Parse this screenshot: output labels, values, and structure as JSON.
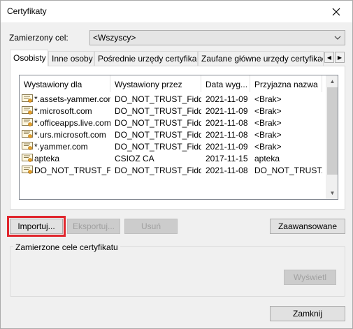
{
  "window": {
    "title": "Certyfikaty"
  },
  "purpose": {
    "label": "Zamierzony cel:",
    "value": "<Wszyscy>"
  },
  "tabs": [
    {
      "label": "Osobisty"
    },
    {
      "label": "Inne osoby"
    },
    {
      "label": "Pośrednie urzędy certyfikacji"
    },
    {
      "label": "Zaufane główne urzędy certyfikacji"
    }
  ],
  "table": {
    "columns": [
      "Wystawiony dla",
      "Wystawiony przez",
      "Data wyg...",
      "Przyjazna nazwa"
    ],
    "rows": [
      {
        "issued_to": "*.assets-yammer.com",
        "issued_by": "DO_NOT_TRUST_Fidd...",
        "expires": "2021-11-09",
        "friendly": "<Brak>"
      },
      {
        "issued_to": "*.microsoft.com",
        "issued_by": "DO_NOT_TRUST_Fidd...",
        "expires": "2021-11-09",
        "friendly": "<Brak>"
      },
      {
        "issued_to": "*.officeapps.live.com",
        "issued_by": "DO_NOT_TRUST_Fidd...",
        "expires": "2021-11-08",
        "friendly": "<Brak>"
      },
      {
        "issued_to": "*.urs.microsoft.com",
        "issued_by": "DO_NOT_TRUST_Fidd...",
        "expires": "2021-11-08",
        "friendly": "<Brak>"
      },
      {
        "issued_to": "*.yammer.com",
        "issued_by": "DO_NOT_TRUST_Fidd...",
        "expires": "2021-11-09",
        "friendly": "<Brak>"
      },
      {
        "issued_to": "apteka",
        "issued_by": "CSIOZ CA",
        "expires": "2017-11-15",
        "friendly": "apteka"
      },
      {
        "issued_to": "DO_NOT_TRUST_Fi...",
        "issued_by": "DO_NOT_TRUST_Fidd...",
        "expires": "2021-11-08",
        "friendly": "DO_NOT_TRUST..."
      }
    ]
  },
  "buttons": {
    "import_label": "Importuj...",
    "export_label": "Eksportuj...",
    "remove_label": "Usuń",
    "advanced_label": "Zaawansowane",
    "view_label": "Wyświetl",
    "close_label": "Zamknij"
  },
  "purposes_group": {
    "label": "Zamierzone cele certyfikatu"
  },
  "colors": {
    "highlight": "#e0262d",
    "window_bg": "#f0f0f0",
    "button_bg": "#e1e1e1"
  }
}
